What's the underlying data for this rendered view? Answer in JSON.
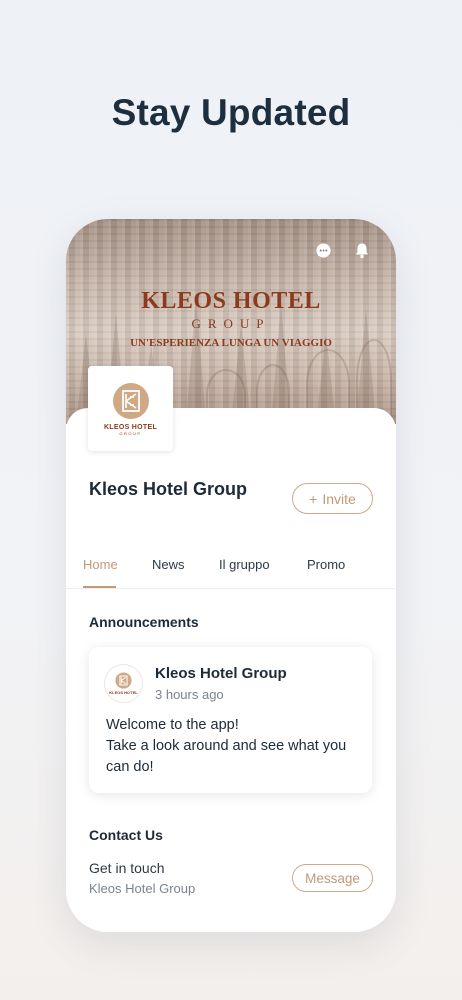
{
  "headline": "Stay Updated",
  "cover": {
    "brand_title": "KLEOS HOTEL",
    "brand_subtitle": "GROUP",
    "tagline": "UN'ESPERIENZA LUNGA UN VIAGGIO"
  },
  "logo": {
    "name": "KLEOS HOTEL",
    "sub": "GROUP"
  },
  "profile": {
    "title": "Kleos Hotel Group",
    "invite_icon": "+",
    "invite_label": "Invite"
  },
  "tabs": [
    {
      "label": "Home",
      "active": true
    },
    {
      "label": "News",
      "active": false
    },
    {
      "label": "Il gruppo",
      "active": false
    },
    {
      "label": "Promo",
      "active": false
    }
  ],
  "announcements": {
    "section_title": "Announcements",
    "author": "Kleos Hotel Group",
    "time": "3 hours ago",
    "line1": "Welcome to the app!",
    "line2": "Take a look around and see what you can do!"
  },
  "contact": {
    "section_title": "Contact Us",
    "main": "Get in touch",
    "sub": "Kleos Hotel Group",
    "button": "Message"
  },
  "colors": {
    "accent": "#c19a78",
    "brand": "#8c3a1e",
    "headline": "#1d2f3f"
  },
  "icons": [
    "chat-bubble-icon",
    "bell-icon",
    "plus-icon",
    "kleos-logo"
  ]
}
